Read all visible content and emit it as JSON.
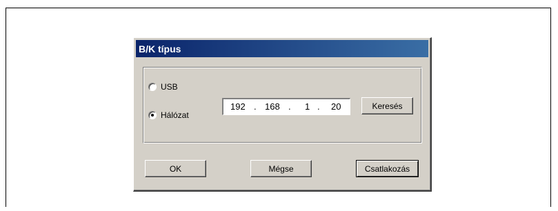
{
  "dialog": {
    "title": "B/K típus",
    "options": {
      "usb_label": "USB",
      "network_label": "Hálózat",
      "selected": "network"
    },
    "ip_address": {
      "octet1": "192",
      "octet2": "168",
      "octet3": "1",
      "octet4": "20",
      "separator": "."
    },
    "search_label": "Keresés",
    "ok_label": "OK",
    "cancel_label": "Mégse",
    "connect_label": "Csatlakozás"
  }
}
